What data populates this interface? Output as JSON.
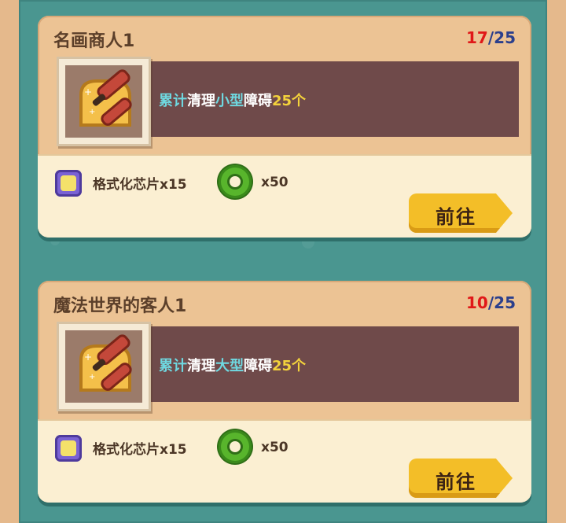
{
  "quests": [
    {
      "title": "名画商人1",
      "progress_current": "17",
      "progress_sep": "/",
      "progress_total": "25",
      "desc": {
        "p1": "累计",
        "p2": "清理",
        "p3": "小型",
        "p4": "障碍",
        "p5": "25个"
      },
      "reward1": "格式化芯片x15",
      "reward2": "x50",
      "button": "前往"
    },
    {
      "title": "魔法世界的客人1",
      "progress_current": "10",
      "progress_sep": "/",
      "progress_total": "25",
      "desc": {
        "p1": "累计",
        "p2": "清理",
        "p3": "大型",
        "p4": "障碍",
        "p5": "25个"
      },
      "reward1": "格式化芯片x15",
      "reward2": "x50",
      "button": "前往"
    }
  ],
  "colors": {
    "accent_cyan": "#6fd8e0",
    "accent_yellow": "#f3d23c",
    "progress_red": "#e01818",
    "progress_blue": "#2b3f8c",
    "button_yellow": "#f3be28"
  },
  "icons": [
    "brush-roller-icon",
    "chip-icon",
    "green-coin-icon"
  ]
}
